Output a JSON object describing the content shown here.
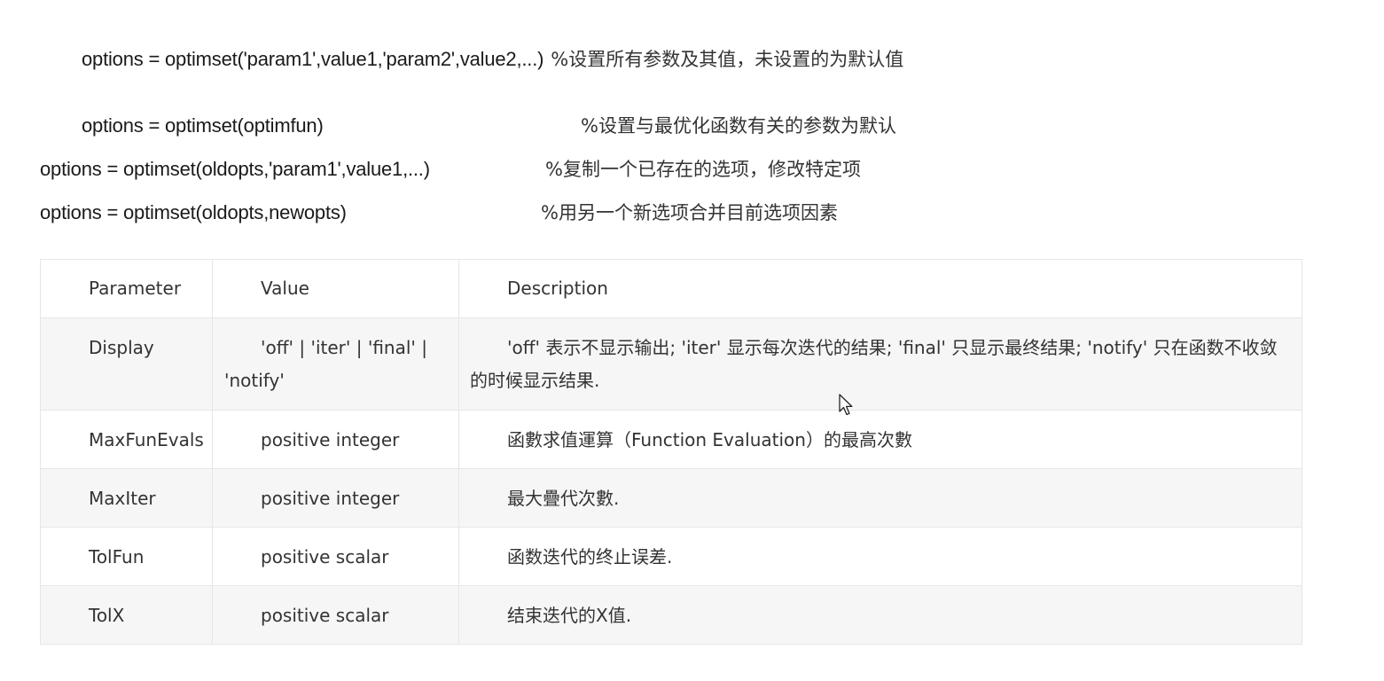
{
  "code_lines": [
    {
      "command": "options = optimset('param1',value1,'param2',value2,...)",
      "comment": "%设置所有参数及其值，未设置的为默认值"
    },
    {
      "command": "options = optimset(optimfun)",
      "comment": "%设置与最优化函数有关的参数为默认"
    },
    {
      "command": "options = optimset(oldopts,'param1',value1,...)",
      "comment": "%复制一个已存在的选项，修改特定项"
    },
    {
      "command": "options = optimset(oldopts,newopts)",
      "comment": "%用另一个新选项合并目前选项因素"
    }
  ],
  "table": {
    "headers": {
      "parameter": "Parameter",
      "value": "Value",
      "description": "Description"
    },
    "rows": [
      {
        "parameter": "Display",
        "value": "'off' | 'iter' | 'final' | 'notify'",
        "description": "'off' 表示不显示输出; 'iter' 显示每次迭代的结果; 'final' 只显示最终结果; 'notify' 只在函数不收敛的时候显示结果."
      },
      {
        "parameter": "MaxFunEvals",
        "value": "positive integer",
        "description": "函數求值運算（Function Evaluation）的最高次數"
      },
      {
        "parameter": "MaxIter",
        "value": "positive integer",
        "description": "最大疊代次數."
      },
      {
        "parameter": "TolFun",
        "value": "positive scalar",
        "description": "函数迭代的终止误差."
      },
      {
        "parameter": "TolX",
        "value": "positive scalar",
        "description": "结束迭代的X值."
      }
    ]
  },
  "icons": {
    "cursor": "mouse-pointer-icon"
  },
  "colors": {
    "table_border": "#e6e6e6",
    "row_alt_background": "#f6f6f6",
    "text": "#333333"
  }
}
